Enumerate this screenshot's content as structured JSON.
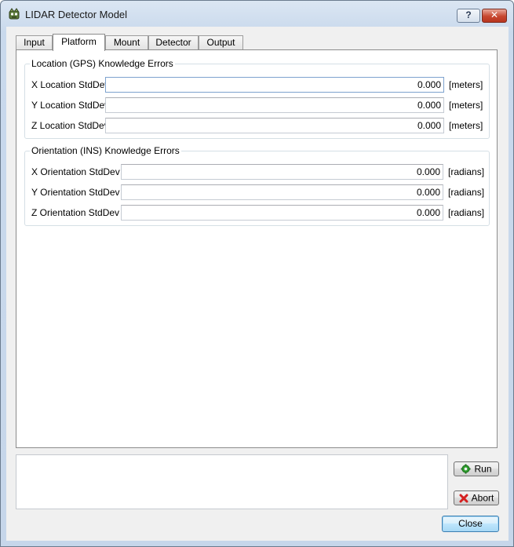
{
  "window": {
    "title": "LIDAR Detector Model",
    "help_label": "?",
    "close_glyph": "✕",
    "icon": "app-icon"
  },
  "tabs": [
    {
      "label": "Input"
    },
    {
      "label": "Platform",
      "active": true
    },
    {
      "label": "Mount"
    },
    {
      "label": "Detector"
    },
    {
      "label": "Output"
    }
  ],
  "location_group": {
    "title": "Location (GPS) Knowledge Errors",
    "rows": [
      {
        "label": "X Location StdDev",
        "value": "0.000",
        "unit": "[meters]"
      },
      {
        "label": "Y Location StdDev",
        "value": "0.000",
        "unit": "[meters]"
      },
      {
        "label": "Z Location StdDev",
        "value": "0.000",
        "unit": "[meters]"
      }
    ]
  },
  "orientation_group": {
    "title": "Orientation (INS) Knowledge Errors",
    "rows": [
      {
        "label": "X Orientation StdDev",
        "value": "0.000",
        "unit": "[radians]"
      },
      {
        "label": "Y Orientation StdDev",
        "value": "0.000",
        "unit": "[radians]"
      },
      {
        "label": "Z Orientation StdDev",
        "value": "0.000",
        "unit": "[radians]"
      }
    ]
  },
  "log": {
    "text": ""
  },
  "buttons": {
    "run": "Run",
    "abort": "Abort",
    "close": "Close"
  },
  "colors": {
    "run_icon": "#2e9e2e",
    "abort_icon": "#d42020",
    "close_button_accent": "#c7472f"
  }
}
